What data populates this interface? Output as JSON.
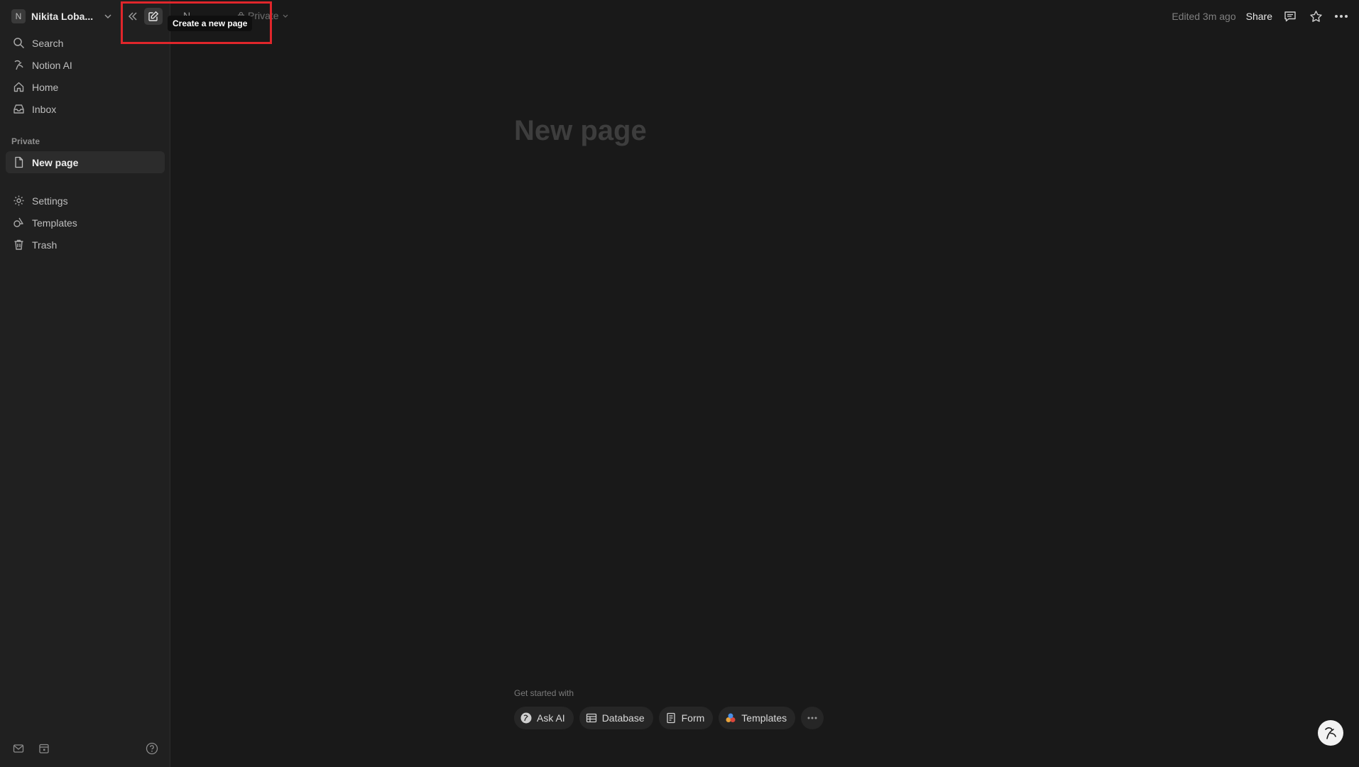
{
  "workspace": {
    "avatar_letter": "N",
    "name": "Nikita Loba..."
  },
  "sidebar": {
    "top_nav": [
      {
        "label": "Search",
        "icon": "search-icon"
      },
      {
        "label": "Notion AI",
        "icon": "notion-ai-icon"
      },
      {
        "label": "Home",
        "icon": "home-icon"
      },
      {
        "label": "Inbox",
        "icon": "inbox-icon"
      }
    ],
    "section_label": "Private",
    "pages": [
      {
        "label": "New page",
        "icon": "page-icon",
        "selected": true
      }
    ],
    "bottom_nav": [
      {
        "label": "Settings",
        "icon": "gear-icon"
      },
      {
        "label": "Templates",
        "icon": "templates-icon"
      },
      {
        "label": "Trash",
        "icon": "trash-icon"
      }
    ]
  },
  "topbar": {
    "breadcrumb_page": "N",
    "privacy_label": "Private",
    "edited": "Edited 3m ago",
    "share_label": "Share"
  },
  "tooltip": {
    "text": "Create a new page"
  },
  "page": {
    "title_placeholder": "New page"
  },
  "get_started": {
    "label": "Get started with",
    "chips": [
      {
        "label": "Ask AI",
        "icon": "notion-ai-icon"
      },
      {
        "label": "Database",
        "icon": "table-icon"
      },
      {
        "label": "Form",
        "icon": "form-icon"
      },
      {
        "label": "Templates",
        "icon": "templates-color-icon"
      }
    ]
  },
  "colors": {
    "background": "#191919",
    "sidebar": "#202020",
    "highlight": "#e0262b"
  }
}
